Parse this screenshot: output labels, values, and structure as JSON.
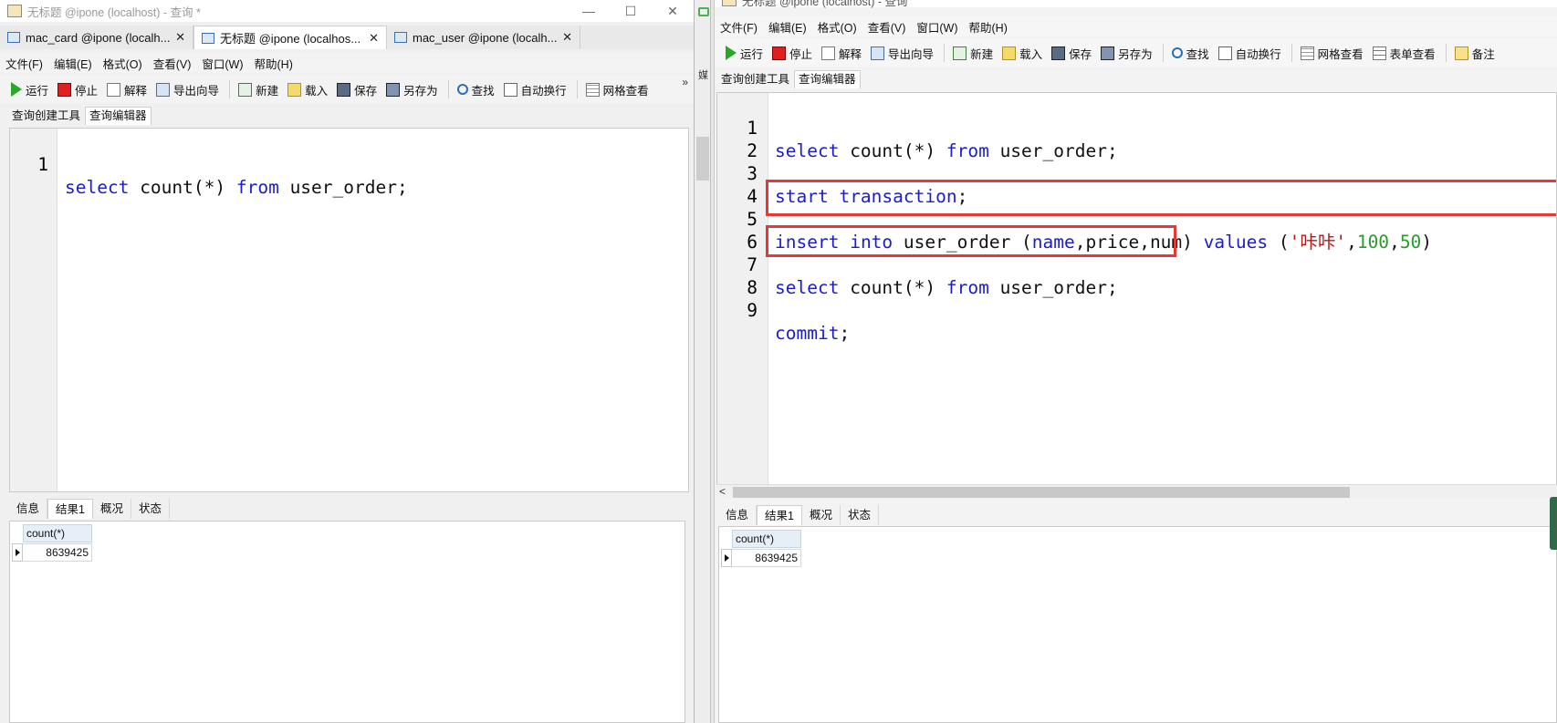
{
  "left_window": {
    "title": "无标题 @ipone (localhost) - 查询 *",
    "controls": {
      "minimize": "—",
      "maximize": "☐",
      "close": "✕"
    },
    "doc_tabs": [
      {
        "label": "mac_card @ipone (localh...",
        "close": "✕"
      },
      {
        "label": "无标题 @ipone (localhos...",
        "close": "✕"
      },
      {
        "label": "mac_user @ipone (localh...",
        "close": "✕"
      }
    ],
    "menu": [
      "文件(F)",
      "编辑(E)",
      "格式(O)",
      "查看(V)",
      "窗口(W)",
      "帮助(H)"
    ],
    "toolbar": {
      "run": "运行",
      "stop": "停止",
      "explain": "解释",
      "export": "导出向导",
      "new": "新建",
      "load": "载入",
      "save": "保存",
      "saveas": "另存为",
      "find": "查找",
      "wrap": "自动换行",
      "grid": "网格查看",
      "more": "»"
    },
    "sub_tabs": [
      "查询创建工具",
      "查询编辑器"
    ],
    "editor": {
      "line_numbers": [
        "1"
      ],
      "line1": {
        "kw1": "select",
        "t1": " count(*) ",
        "kw2": "from",
        "t2": " user_order;"
      }
    },
    "result_tabs": [
      "信息",
      "结果1",
      "概况",
      "状态"
    ],
    "result": {
      "column": "count(*)",
      "value": "8639425"
    }
  },
  "gap": {
    "text": "媒"
  },
  "right_window": {
    "title": "无标题 @ipone (localhost) - 查询",
    "menu": [
      "文件(F)",
      "编辑(E)",
      "格式(O)",
      "查看(V)",
      "窗口(W)",
      "帮助(H)"
    ],
    "toolbar": {
      "run": "运行",
      "stop": "停止",
      "explain": "解释",
      "export": "导出向导",
      "new": "新建",
      "load": "载入",
      "save": "保存",
      "saveas": "另存为",
      "find": "查找",
      "wrap": "自动换行",
      "grid": "网格查看",
      "form": "表单查看",
      "note": "备注"
    },
    "sub_tabs": [
      "查询创建工具",
      "查询编辑器"
    ],
    "editor": {
      "line_numbers": [
        "1",
        "2",
        "3",
        "4",
        "5",
        "6",
        "7",
        "8",
        "9"
      ],
      "line1": {
        "kw1": "select",
        "t1": " count(*) ",
        "kw2": "from",
        "t2": " user_order;"
      },
      "line3": {
        "kw1": "start",
        "t1": " ",
        "kw2": "transaction",
        "t2": ";"
      },
      "line5": {
        "kw1": "insert",
        "t1": " ",
        "kw2": "into",
        "t2": " user_order (",
        "kw3": "name",
        "t3": ",price,num) ",
        "kw4": "values",
        "t4": " (",
        "s1": "'咔咔'",
        "t5": ",",
        "n1": "100",
        "t6": ",",
        "n2": "50",
        "t7": ")"
      },
      "line7": {
        "kw1": "select",
        "t1": " count(*) ",
        "kw2": "from",
        "t2": " user_order;"
      },
      "line9": {
        "kw1": "commit",
        "t1": ";"
      }
    },
    "scroll_left": "<",
    "result_tabs": [
      "信息",
      "结果1",
      "概况",
      "状态"
    ],
    "result": {
      "column": "count(*)",
      "value": "8639425"
    }
  },
  "colors": {
    "keyword": "#1c1ccc",
    "string": "#b01818",
    "number": "#2a9a2a",
    "highlight_box": "#e53935"
  }
}
